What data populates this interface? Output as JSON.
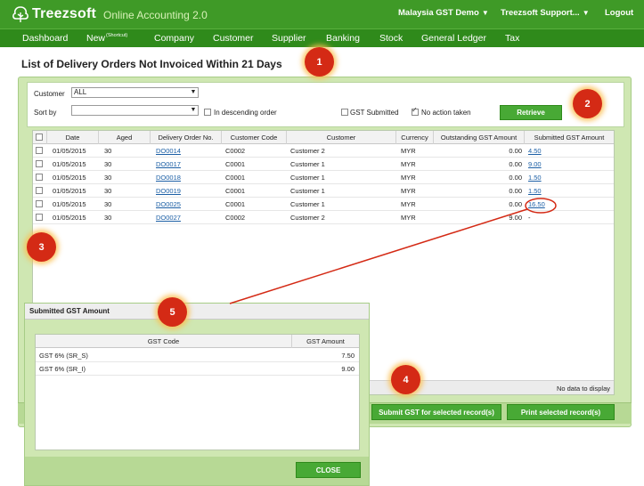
{
  "app": {
    "brand": "Treezsoft",
    "subtitle": "Online Accounting 2.0",
    "company_menu": "Malaysia GST Demo",
    "support_menu": "Treezsoft Support...",
    "logout": "Logout"
  },
  "nav": {
    "dashboard": "Dashboard",
    "new": "New",
    "new_sup": "(Shortcut)",
    "company": "Company",
    "customer": "Customer",
    "supplier": "Supplier",
    "banking": "Banking",
    "stock": "Stock",
    "general_ledger": "General Ledger",
    "tax": "Tax"
  },
  "page_title": "List of Delivery Orders Not Invoiced Within 21 Days",
  "filters": {
    "customer_label": "Customer",
    "customer_value": "ALL",
    "sort_label": "Sort by",
    "sort_value": "",
    "descending_label": "In descending order",
    "descending_checked": false,
    "gst_submitted_label": "GST Submitted",
    "gst_submitted_checked": false,
    "no_action_label": "No action taken",
    "no_action_checked": true,
    "retrieve": "Retrieve"
  },
  "table": {
    "columns": [
      "Date",
      "Aged",
      "Delivery Order No.",
      "Customer Code",
      "Customer",
      "Currency",
      "Outstanding GST Amount",
      "Submitted GST Amount"
    ],
    "rows": [
      {
        "date": "01/05/2015",
        "aged": "30",
        "do_no": "DO0014",
        "code": "C0002",
        "customer": "Customer 2",
        "currency": "MYR",
        "outstanding": "0.00",
        "submitted": "4.50"
      },
      {
        "date": "01/05/2015",
        "aged": "30",
        "do_no": "DO0017",
        "code": "C0001",
        "customer": "Customer 1",
        "currency": "MYR",
        "outstanding": "0.00",
        "submitted": "9.00"
      },
      {
        "date": "01/05/2015",
        "aged": "30",
        "do_no": "DO0018",
        "code": "C0001",
        "customer": "Customer 1",
        "currency": "MYR",
        "outstanding": "0.00",
        "submitted": "1.50"
      },
      {
        "date": "01/05/2015",
        "aged": "30",
        "do_no": "DO0019",
        "code": "C0001",
        "customer": "Customer 1",
        "currency": "MYR",
        "outstanding": "0.00",
        "submitted": "1.50"
      },
      {
        "date": "01/05/2015",
        "aged": "30",
        "do_no": "DO0025",
        "code": "C0001",
        "customer": "Customer 1",
        "currency": "MYR",
        "outstanding": "0.00",
        "submitted": "16.50"
      },
      {
        "date": "01/05/2015",
        "aged": "30",
        "do_no": "DO0027",
        "code": "C0002",
        "customer": "Customer 2",
        "currency": "MYR",
        "outstanding": "9.00",
        "submitted": "-"
      }
    ],
    "footer": "No data to display"
  },
  "actions": {
    "submit_gst": "Submit GST for selected record(s)",
    "print": "Print selected record(s)"
  },
  "popup": {
    "title": "Submitted GST Amount",
    "columns": [
      "GST Code",
      "GST Amount"
    ],
    "rows": [
      {
        "code": "GST 6% (SR_S)",
        "amount": "7.50"
      },
      {
        "code": "GST 6% (SR_I)",
        "amount": "9.00"
      }
    ],
    "close": "CLOSE"
  },
  "callouts": [
    "1",
    "2",
    "3",
    "4",
    "5"
  ],
  "colors": {
    "header_green": "#3f9a27",
    "nav_green": "#2f8a1b",
    "panel_green": "#cfe7b2",
    "button_green": "#48a935",
    "callout_red": "#d42a15",
    "link_blue": "#1c5fa5"
  }
}
